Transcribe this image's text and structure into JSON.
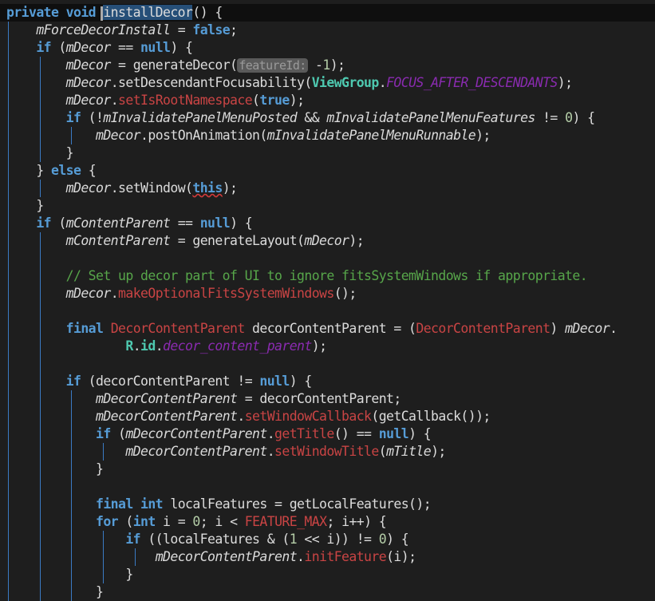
{
  "editor": {
    "colors": {
      "background": "#1e1e1e",
      "keyword": "#569cd6",
      "field": "#dadada",
      "api": "#c94444",
      "constant": "#8a2bb0",
      "type": "#4ec9b0",
      "number": "#b5cea8",
      "comment": "#57a64a",
      "selection": "#264f78"
    },
    "lines": [
      {
        "i": 0,
        "tk": [
          [
            "k",
            "private void "
          ],
          [
            "cursor",
            ""
          ],
          [
            "s",
            "installDecor"
          ],
          [
            "p",
            "() {"
          ]
        ]
      },
      {
        "i": 1,
        "tk": [
          [
            "f",
            "mForceDecorInstall"
          ],
          [
            "p",
            " = "
          ],
          [
            "k",
            "false"
          ],
          [
            "p",
            ";"
          ]
        ]
      },
      {
        "i": 1,
        "tk": [
          [
            "k",
            "if"
          ],
          [
            "p",
            " ("
          ],
          [
            "f",
            "mDecor"
          ],
          [
            "p",
            " == "
          ],
          [
            "k",
            "null"
          ],
          [
            "p",
            ") {"
          ]
        ]
      },
      {
        "i": 2,
        "tk": [
          [
            "f",
            "mDecor"
          ],
          [
            "p",
            " = generateDecor("
          ],
          [
            "h",
            "featureId:"
          ],
          [
            "p",
            " -"
          ],
          [
            "n",
            "1"
          ],
          [
            "p",
            ");"
          ]
        ]
      },
      {
        "i": 2,
        "tk": [
          [
            "f",
            "mDecor"
          ],
          [
            "p",
            ".setDescendantFocusability("
          ],
          [
            "t",
            "ViewGroup"
          ],
          [
            "p",
            "."
          ],
          [
            "c",
            "FOCUS_AFTER_DESCENDANTS"
          ],
          [
            "p",
            ");"
          ]
        ]
      },
      {
        "i": 2,
        "tk": [
          [
            "f",
            "mDecor"
          ],
          [
            "p",
            "."
          ],
          [
            "m",
            "setIsRootNamespace"
          ],
          [
            "p",
            "("
          ],
          [
            "k",
            "true"
          ],
          [
            "p",
            ");"
          ]
        ]
      },
      {
        "i": 2,
        "tk": [
          [
            "k",
            "if"
          ],
          [
            "p",
            " (!"
          ],
          [
            "f",
            "mInvalidatePanelMenuPosted"
          ],
          [
            "p",
            " && "
          ],
          [
            "f",
            "mInvalidatePanelMenuFeatures"
          ],
          [
            "p",
            " != "
          ],
          [
            "n",
            "0"
          ],
          [
            "p",
            ") {"
          ]
        ]
      },
      {
        "i": 3,
        "tk": [
          [
            "f",
            "mDecor"
          ],
          [
            "p",
            ".postOnAnimation("
          ],
          [
            "f",
            "mInvalidatePanelMenuRunnable"
          ],
          [
            "p",
            ");"
          ]
        ]
      },
      {
        "i": 2,
        "tk": [
          [
            "p",
            "}"
          ]
        ]
      },
      {
        "i": 1,
        "tk": [
          [
            "p",
            "} "
          ],
          [
            "k",
            "else"
          ],
          [
            "p",
            " {"
          ]
        ]
      },
      {
        "i": 2,
        "tk": [
          [
            "f",
            "mDecor"
          ],
          [
            "p",
            ".setWindow("
          ],
          [
            "kw",
            "this"
          ],
          [
            "p",
            ");"
          ]
        ]
      },
      {
        "i": 1,
        "tk": [
          [
            "p",
            "}"
          ]
        ]
      },
      {
        "i": 1,
        "tk": [
          [
            "k",
            "if"
          ],
          [
            "p",
            " ("
          ],
          [
            "f",
            "mContentParent"
          ],
          [
            "p",
            " == "
          ],
          [
            "k",
            "null"
          ],
          [
            "p",
            ") {"
          ]
        ]
      },
      {
        "i": 2,
        "tk": [
          [
            "f",
            "mContentParent"
          ],
          [
            "p",
            " = generateLayout("
          ],
          [
            "f",
            "mDecor"
          ],
          [
            "p",
            ");"
          ]
        ]
      },
      {
        "i": 2,
        "tk": []
      },
      {
        "i": 2,
        "tk": [
          [
            "cm",
            "// Set up decor part of UI to ignore fitsSystemWindows if appropriate."
          ]
        ]
      },
      {
        "i": 2,
        "tk": [
          [
            "f",
            "mDecor"
          ],
          [
            "p",
            "."
          ],
          [
            "m",
            "makeOptionalFitsSystemWindows"
          ],
          [
            "p",
            "();"
          ]
        ]
      },
      {
        "i": 2,
        "tk": []
      },
      {
        "i": 2,
        "tk": [
          [
            "k",
            "final "
          ],
          [
            "m",
            "DecorContentParent"
          ],
          [
            "p",
            " decorContentParent = ("
          ],
          [
            "m",
            "DecorContentParent"
          ],
          [
            "p",
            ") "
          ],
          [
            "f",
            "mDecor"
          ],
          [
            "p",
            "."
          ]
        ]
      },
      {
        "i": 2,
        "x": 8,
        "tk": [
          [
            "t",
            "R"
          ],
          [
            "p",
            "."
          ],
          [
            "t",
            "id"
          ],
          [
            "p",
            "."
          ],
          [
            "c",
            "decor_content_parent"
          ],
          [
            "p",
            ");"
          ]
        ]
      },
      {
        "i": 2,
        "tk": []
      },
      {
        "i": 2,
        "tk": [
          [
            "k",
            "if"
          ],
          [
            "p",
            " (decorContentParent != "
          ],
          [
            "k",
            "null"
          ],
          [
            "p",
            ") {"
          ]
        ]
      },
      {
        "i": 3,
        "tk": [
          [
            "f",
            "mDecorContentParent"
          ],
          [
            "p",
            " = decorContentParent;"
          ]
        ]
      },
      {
        "i": 3,
        "tk": [
          [
            "f",
            "mDecorContentParent"
          ],
          [
            "p",
            "."
          ],
          [
            "m",
            "setWindowCallback"
          ],
          [
            "p",
            "(getCallback());"
          ]
        ]
      },
      {
        "i": 3,
        "tk": [
          [
            "k",
            "if"
          ],
          [
            "p",
            " ("
          ],
          [
            "f",
            "mDecorContentParent"
          ],
          [
            "p",
            "."
          ],
          [
            "m",
            "getTitle"
          ],
          [
            "p",
            "() == "
          ],
          [
            "k",
            "null"
          ],
          [
            "p",
            ") {"
          ]
        ]
      },
      {
        "i": 4,
        "tk": [
          [
            "f",
            "mDecorContentParent"
          ],
          [
            "p",
            "."
          ],
          [
            "m",
            "setWindowTitle"
          ],
          [
            "p",
            "("
          ],
          [
            "f",
            "mTitle"
          ],
          [
            "p",
            ");"
          ]
        ]
      },
      {
        "i": 3,
        "tk": [
          [
            "p",
            "}"
          ]
        ]
      },
      {
        "i": 3,
        "tk": []
      },
      {
        "i": 3,
        "tk": [
          [
            "k",
            "final int"
          ],
          [
            "p",
            " localFeatures = getLocalFeatures();"
          ]
        ]
      },
      {
        "i": 3,
        "tk": [
          [
            "k",
            "for"
          ],
          [
            "p",
            " ("
          ],
          [
            "k",
            "int"
          ],
          [
            "p",
            " i = "
          ],
          [
            "n",
            "0"
          ],
          [
            "p",
            "; i < "
          ],
          [
            "m",
            "FEATURE_MAX"
          ],
          [
            "p",
            "; i++) {"
          ]
        ]
      },
      {
        "i": 4,
        "tk": [
          [
            "k",
            "if"
          ],
          [
            "p",
            " ((localFeatures & ("
          ],
          [
            "n",
            "1"
          ],
          [
            "p",
            " << i)) != "
          ],
          [
            "n",
            "0"
          ],
          [
            "p",
            ") {"
          ]
        ]
      },
      {
        "i": 5,
        "tk": [
          [
            "f",
            "mDecorContentParent"
          ],
          [
            "p",
            "."
          ],
          [
            "m",
            "initFeature"
          ],
          [
            "p",
            "(i);"
          ]
        ]
      },
      {
        "i": 4,
        "tk": [
          [
            "p",
            "}"
          ]
        ]
      },
      {
        "i": 3,
        "tk": [
          [
            "p",
            "}"
          ]
        ]
      }
    ]
  }
}
